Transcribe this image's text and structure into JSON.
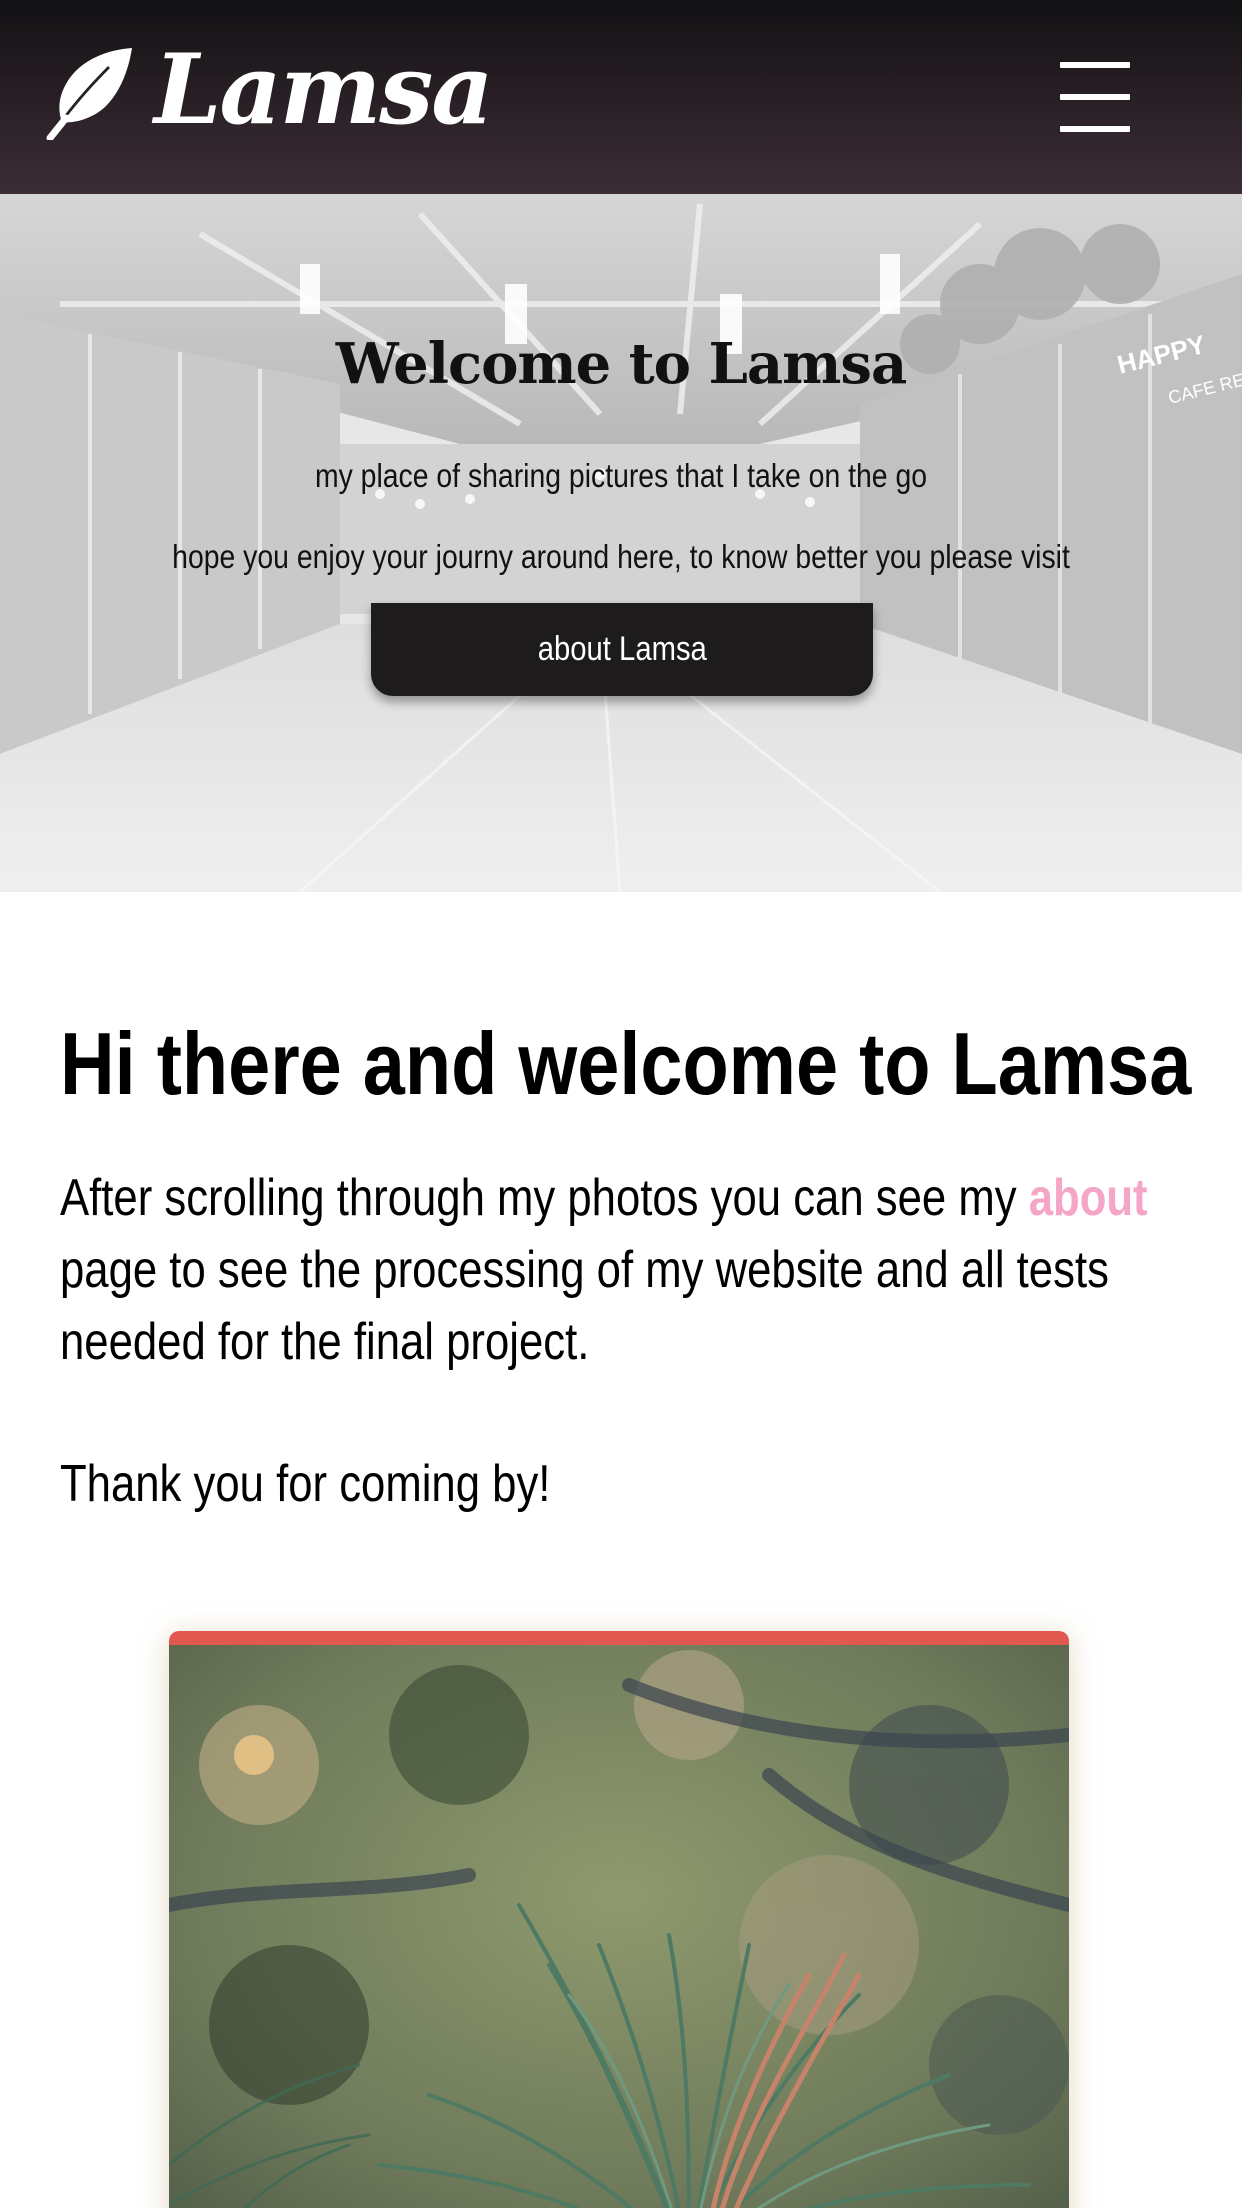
{
  "header": {
    "brand_name": "Lamsa",
    "logo_icon": "feather-icon",
    "menu_icon": "hamburger-menu-icon"
  },
  "hero": {
    "title": "Welcome to Lamsa",
    "line1": "my place of sharing pictures that I take on the go",
    "line2": "hope you enjoy your journy around here, to know better you please visit",
    "button_label": "about Lamsa",
    "background": "airport-terminal-photo-grayscale"
  },
  "intro": {
    "heading": "Hi there and welcome to Lamsa",
    "para_lead": "After scrolling through my photos you can see my",
    "about_link": "about",
    "para_line2": "page to see the processing of my website and all tests",
    "para_line3": "needed for the final project.",
    "thanks": "Thank you for coming by!"
  },
  "gallery": {
    "photo": "pine-needles-photo"
  },
  "colors": {
    "header_top": "#121113",
    "header_bottom": "#3c2d37",
    "button_bg": "#1d1b1c",
    "link": "#f5a6c7",
    "card_accent": "#e0584f"
  }
}
